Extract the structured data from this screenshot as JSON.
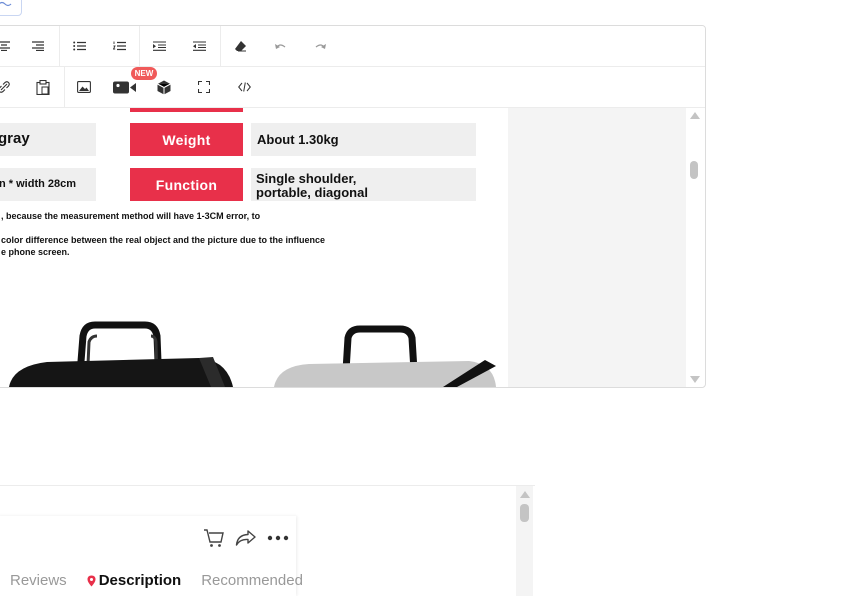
{
  "editor": {
    "new_badge": "NEW"
  },
  "specs": {
    "row1_left_value": "gray",
    "row1_label": "Weight",
    "row1_value": "About 1.30kg",
    "row2_left_value": "n * width 28cm",
    "row2_label": "Function",
    "row2_value_line1": "Single shoulder,",
    "row2_value_line2": "portable, diagonal"
  },
  "notes": {
    "line1": ", because the measurement method will have 1-3CM error, to",
    "line2": "color difference between the real object and the picture due to the influence",
    "line3": "e phone screen."
  },
  "product_nav": {
    "tabs": [
      "Reviews",
      "Description",
      "Recommended"
    ],
    "active_tab": "Description"
  },
  "colors": {
    "accent_red": "#e8304a",
    "location_pin": "#e8304a",
    "badge": "#f05a5a"
  }
}
